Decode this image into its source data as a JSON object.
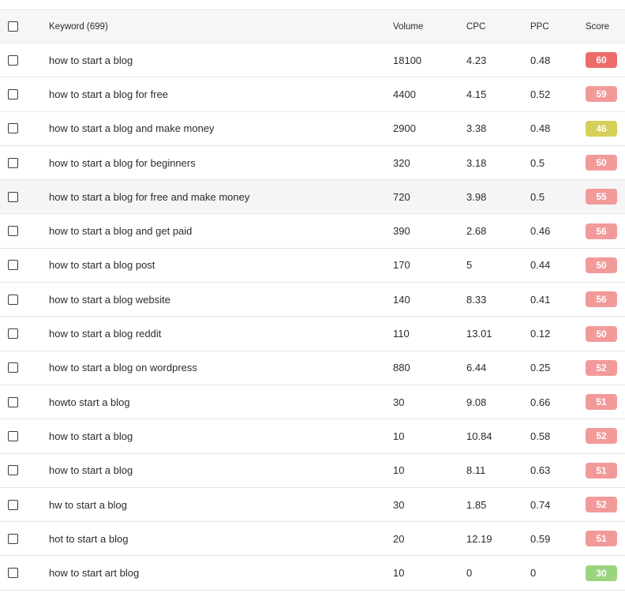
{
  "header": {
    "keyword_label": "Keyword (699)",
    "volume_label": "Volume",
    "cpc_label": "CPC",
    "ppc_label": "PPC",
    "score_label": "Score"
  },
  "rows": [
    {
      "keyword": "how to start a blog",
      "volume": "18100",
      "cpc": "4.23",
      "ppc": "0.48",
      "score": "60",
      "score_color": "#ee6b6b"
    },
    {
      "keyword": "how to start a blog for free",
      "volume": "4400",
      "cpc": "4.15",
      "ppc": "0.52",
      "score": "59",
      "score_color": "#f29a9a"
    },
    {
      "keyword": "how to start a blog and make money",
      "volume": "2900",
      "cpc": "3.38",
      "ppc": "0.48",
      "score": "46",
      "score_color": "#d6cf58"
    },
    {
      "keyword": "how to start a blog for beginners",
      "volume": "320",
      "cpc": "3.18",
      "ppc": "0.5",
      "score": "50",
      "score_color": "#f29a9a"
    },
    {
      "keyword": "how to start a blog for free and make money",
      "volume": "720",
      "cpc": "3.98",
      "ppc": "0.5",
      "score": "55",
      "score_color": "#f29a9a"
    },
    {
      "keyword": "how to start a blog and get paid",
      "volume": "390",
      "cpc": "2.68",
      "ppc": "0.46",
      "score": "56",
      "score_color": "#f29a9a"
    },
    {
      "keyword": "how to start a blog post",
      "volume": "170",
      "cpc": "5",
      "ppc": "0.44",
      "score": "50",
      "score_color": "#f29a9a"
    },
    {
      "keyword": "how to start a blog website",
      "volume": "140",
      "cpc": "8.33",
      "ppc": "0.41",
      "score": "56",
      "score_color": "#f29a9a"
    },
    {
      "keyword": "how to start a blog reddit",
      "volume": "110",
      "cpc": "13.01",
      "ppc": "0.12",
      "score": "50",
      "score_color": "#f29a9a"
    },
    {
      "keyword": "how to start a blog on wordpress",
      "volume": "880",
      "cpc": "6.44",
      "ppc": "0.25",
      "score": "52",
      "score_color": "#f29a9a"
    },
    {
      "keyword": "howto start a blog",
      "volume": "30",
      "cpc": "9.08",
      "ppc": "0.66",
      "score": "51",
      "score_color": "#f29a9a"
    },
    {
      "keyword": "how to start a blog",
      "volume": "10",
      "cpc": "10.84",
      "ppc": "0.58",
      "score": "52",
      "score_color": "#f29a9a"
    },
    {
      "keyword": "how to start a blog",
      "volume": "10",
      "cpc": "8.11",
      "ppc": "0.63",
      "score": "51",
      "score_color": "#f29a9a"
    },
    {
      "keyword": "hw to start a blog",
      "volume": "30",
      "cpc": "1.85",
      "ppc": "0.74",
      "score": "52",
      "score_color": "#f29a9a"
    },
    {
      "keyword": "hot to start a blog",
      "volume": "20",
      "cpc": "12.19",
      "ppc": "0.59",
      "score": "51",
      "score_color": "#f29a9a"
    },
    {
      "keyword": "how to start art blog",
      "volume": "10",
      "cpc": "0",
      "ppc": "0",
      "score": "30",
      "score_color": "#9bd47e"
    }
  ]
}
